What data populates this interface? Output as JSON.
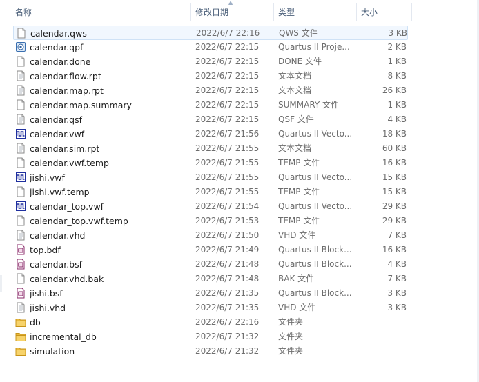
{
  "headers": {
    "name": "名称",
    "date": "修改日期",
    "type": "类型",
    "size": "大小"
  },
  "files": [
    {
      "name": "calendar.qws",
      "date": "2022/6/7 22:16",
      "type": "QWS 文件",
      "size": "3 KB",
      "icon": "doc-icon",
      "selected": true
    },
    {
      "name": "calendar.qpf",
      "date": "2022/6/7 22:15",
      "type": "Quartus II Proje...",
      "size": "2 KB",
      "icon": "quartus-project-icon"
    },
    {
      "name": "calendar.done",
      "date": "2022/6/7 22:15",
      "type": "DONE 文件",
      "size": "1 KB",
      "icon": "doc-icon"
    },
    {
      "name": "calendar.flow.rpt",
      "date": "2022/6/7 22:15",
      "type": "文本文档",
      "size": "8 KB",
      "icon": "text-doc-icon"
    },
    {
      "name": "calendar.map.rpt",
      "date": "2022/6/7 22:15",
      "type": "文本文档",
      "size": "26 KB",
      "icon": "text-doc-icon"
    },
    {
      "name": "calendar.map.summary",
      "date": "2022/6/7 22:15",
      "type": "SUMMARY 文件",
      "size": "1 KB",
      "icon": "doc-icon"
    },
    {
      "name": "calendar.qsf",
      "date": "2022/6/7 22:15",
      "type": "QSF 文件",
      "size": "4 KB",
      "icon": "text-doc-icon"
    },
    {
      "name": "calendar.vwf",
      "date": "2022/6/7 21:56",
      "type": "Quartus II Vecto...",
      "size": "18 KB",
      "icon": "waveform-icon"
    },
    {
      "name": "calendar.sim.rpt",
      "date": "2022/6/7 21:55",
      "type": "文本文档",
      "size": "60 KB",
      "icon": "text-doc-icon"
    },
    {
      "name": "calendar.vwf.temp",
      "date": "2022/6/7 21:55",
      "type": "TEMP 文件",
      "size": "16 KB",
      "icon": "doc-icon"
    },
    {
      "name": "jishi.vwf",
      "date": "2022/6/7 21:55",
      "type": "Quartus II Vecto...",
      "size": "15 KB",
      "icon": "waveform-icon"
    },
    {
      "name": "jishi.vwf.temp",
      "date": "2022/6/7 21:55",
      "type": "TEMP 文件",
      "size": "15 KB",
      "icon": "doc-icon"
    },
    {
      "name": "calendar_top.vwf",
      "date": "2022/6/7 21:54",
      "type": "Quartus II Vecto...",
      "size": "29 KB",
      "icon": "waveform-icon"
    },
    {
      "name": "calendar_top.vwf.temp",
      "date": "2022/6/7 21:53",
      "type": "TEMP 文件",
      "size": "29 KB",
      "icon": "doc-icon"
    },
    {
      "name": "calendar.vhd",
      "date": "2022/6/7 21:50",
      "type": "VHD 文件",
      "size": "7 KB",
      "icon": "text-doc-icon"
    },
    {
      "name": "top.bdf",
      "date": "2022/6/7 21:49",
      "type": "Quartus II Block...",
      "size": "16 KB",
      "icon": "block-diagram-icon"
    },
    {
      "name": "calendar.bsf",
      "date": "2022/6/7 21:48",
      "type": "Quartus II Block...",
      "size": "4 KB",
      "icon": "block-diagram-icon"
    },
    {
      "name": "calendar.vhd.bak",
      "date": "2022/6/7 21:48",
      "type": "BAK 文件",
      "size": "7 KB",
      "icon": "doc-icon"
    },
    {
      "name": "jishi.bsf",
      "date": "2022/6/7 21:35",
      "type": "Quartus II Block...",
      "size": "3 KB",
      "icon": "block-diagram-icon"
    },
    {
      "name": "jishi.vhd",
      "date": "2022/6/7 21:35",
      "type": "VHD 文件",
      "size": "3 KB",
      "icon": "text-doc-icon"
    },
    {
      "name": "db",
      "date": "2022/6/7 22:16",
      "type": "文件夹",
      "size": "",
      "icon": "folder-icon"
    },
    {
      "name": "incremental_db",
      "date": "2022/6/7 21:32",
      "type": "文件夹",
      "size": "",
      "icon": "folder-icon"
    },
    {
      "name": "simulation",
      "date": "2022/6/7 21:32",
      "type": "文件夹",
      "size": "",
      "icon": "folder-icon"
    }
  ]
}
